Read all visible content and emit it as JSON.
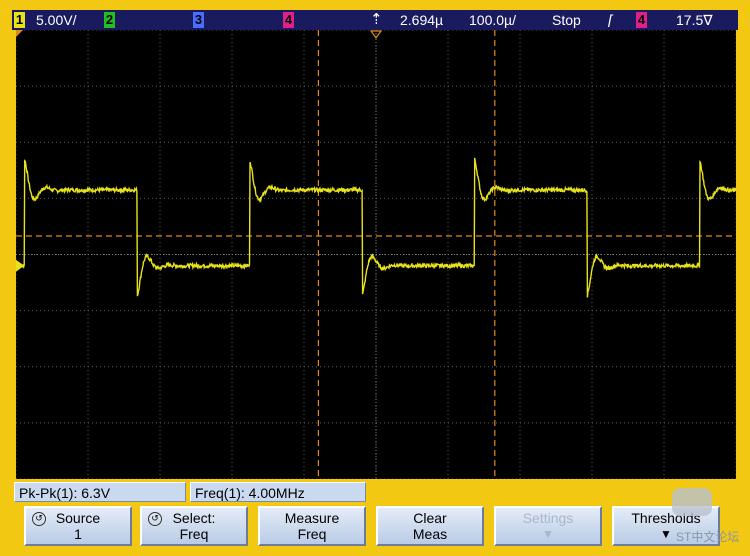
{
  "status": {
    "ch1_num": "1",
    "ch1_scale": "5.00V/",
    "ch2_num": "2",
    "ch3_num": "3",
    "ch4_num": "4",
    "trigger_delay": "2.694µ",
    "timebase": "100.0µ/",
    "run_state": "Stop",
    "trigger_source": "4",
    "trigger_level": "17.5∇"
  },
  "markers": {
    "ch1_ground": "1"
  },
  "measurements": {
    "pkpk": "Pk-Pk(1): 6.3V",
    "freq": "Freq(1): 4.00MHz"
  },
  "softkeys": [
    {
      "line1": "Source",
      "line2": "1"
    },
    {
      "line1": "Select:",
      "line2": "Freq"
    },
    {
      "line1": "Measure",
      "line2": "Freq"
    },
    {
      "line1": "Clear",
      "line2": "Meas"
    },
    {
      "line1": "Settings",
      "line2": ""
    },
    {
      "line1": "Thresholds",
      "line2": ""
    }
  ],
  "watermark": "ST中文论坛",
  "colors": {
    "frame": "#f2c812",
    "ch1": "#e8e21a",
    "ch2": "#20c020",
    "ch3": "#4a6cff",
    "ch4": "#e0208a",
    "cursor": "#e08a1a",
    "status_bg": "#1a1a5e"
  },
  "chart_data": {
    "type": "line",
    "title": "",
    "xlabel": "",
    "ylabel": "",
    "xlim": [
      0,
      10
    ],
    "ylim": [
      -4,
      4
    ],
    "grid": true,
    "series": [
      {
        "period": 3.125,
        "high": 1.15,
        "low": -0.2,
        "start_phase": 0.12,
        "duty": 0.45
      }
    ],
    "trigger_level_line": 0.33,
    "cursors_x": [
      4.2,
      6.65
    ]
  }
}
